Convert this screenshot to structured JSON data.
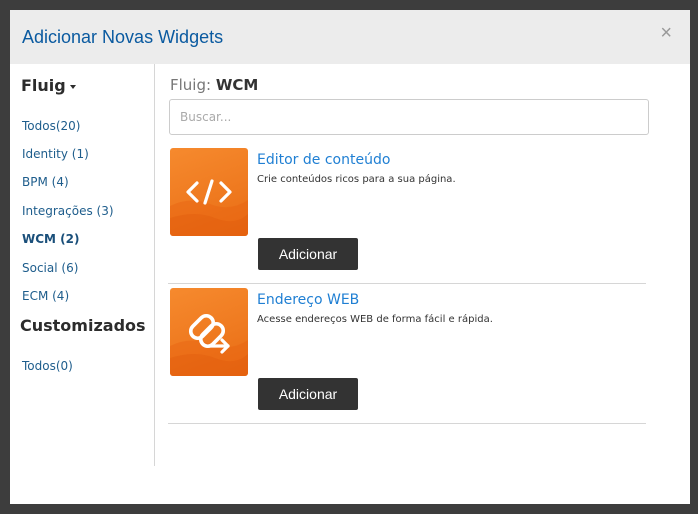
{
  "modal": {
    "title": "Adicionar Novas Widgets",
    "close_glyph": "×"
  },
  "sidebar": {
    "group_heading": "Fluig",
    "items": [
      {
        "label": "Todos(20)"
      },
      {
        "label": "Identity (1)"
      },
      {
        "label": "BPM (4)"
      },
      {
        "label": "Integrações (3)"
      },
      {
        "label": "WCM (2)",
        "active": true
      },
      {
        "label": "Social (6)"
      },
      {
        "label": "ECM (4)"
      }
    ],
    "custom_heading": "Customizados",
    "custom_items": [
      {
        "label": "Todos(0)"
      }
    ]
  },
  "content": {
    "title_prefix": "Fluig:",
    "title_category": "WCM",
    "search_placeholder": "Buscar...",
    "widgets": [
      {
        "name": "Editor de conteúdo",
        "description": "Crie conteúdos ricos para a sua página.",
        "icon": "code-icon",
        "add_label": "Adicionar"
      },
      {
        "name": "Endereço WEB",
        "description": "Acesse endereços WEB de forma fácil e rápida.",
        "icon": "link-icon",
        "add_label": "Adicionar"
      }
    ]
  },
  "colors": {
    "accent": "#1f7fd3",
    "title": "#0a5aa0",
    "thumb_orange": "#f0781e",
    "button": "#333333"
  }
}
